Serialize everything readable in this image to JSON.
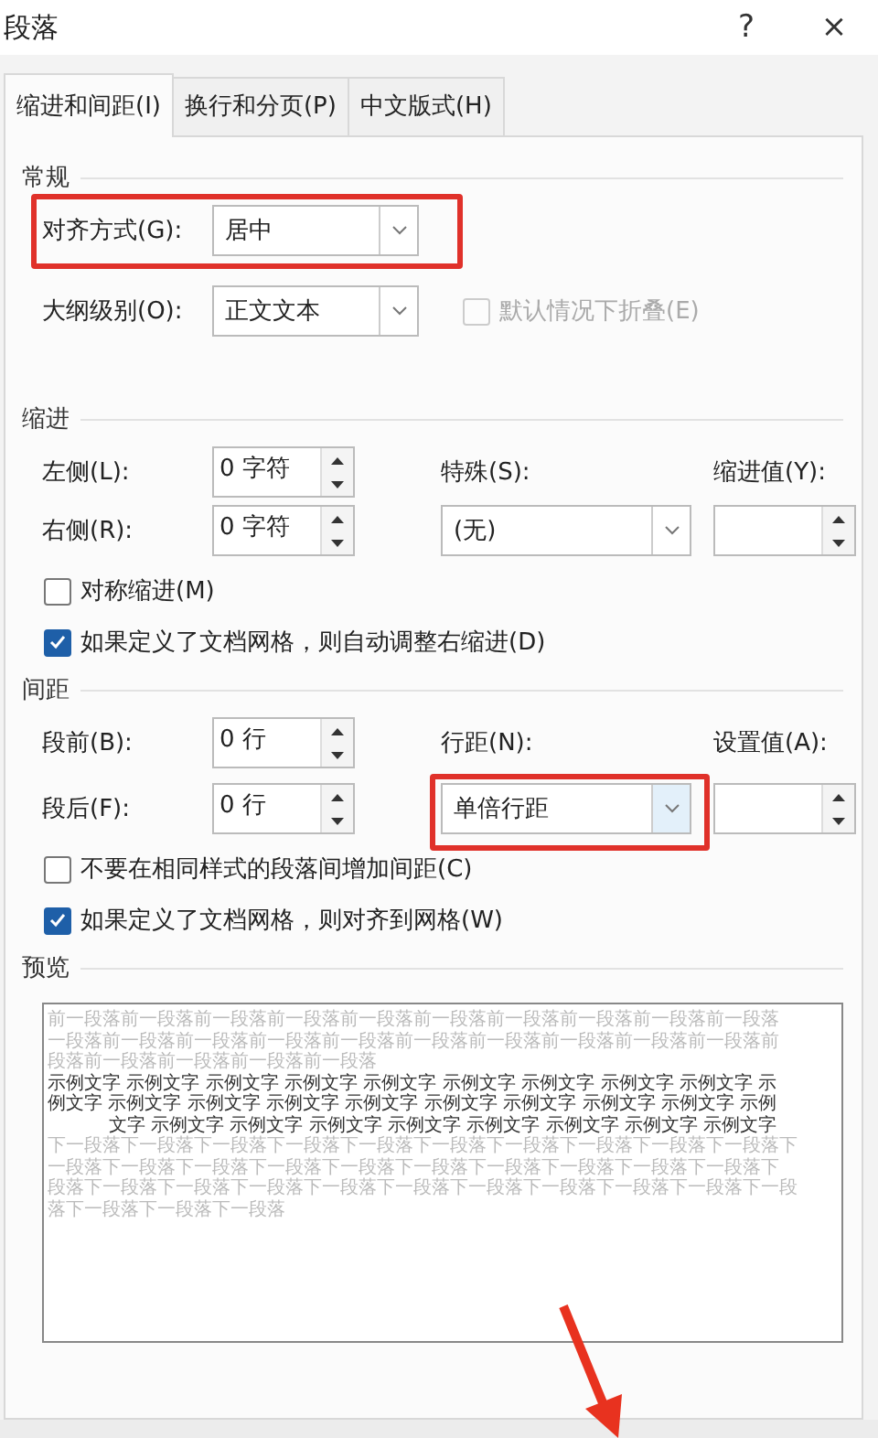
{
  "window": {
    "title": "段落",
    "help": "?",
    "close": "×"
  },
  "tabs": [
    {
      "label": "缩进和间距(I)",
      "selected": true
    },
    {
      "label": "换行和分页(P)",
      "selected": false
    },
    {
      "label": "中文版式(H)",
      "selected": false
    }
  ],
  "general": {
    "heading": "常规",
    "alignment": {
      "label": "对齐方式(G):",
      "value": "居中"
    },
    "outline_level": {
      "label": "大纲级别(O):",
      "value": "正文文本"
    },
    "collapse": {
      "label": "默认情况下折叠(E)",
      "checked": false,
      "disabled": true
    }
  },
  "indent": {
    "heading": "缩进",
    "left": {
      "label": "左侧(L):",
      "value": "0 字符"
    },
    "right": {
      "label": "右侧(R):",
      "value": "0 字符"
    },
    "special": {
      "label": "特殊(S):",
      "value": "(无)"
    },
    "by": {
      "label": "缩进值(Y):"
    },
    "checkboxes": [
      {
        "label": "对称缩进(M)",
        "checked": false
      },
      {
        "label": "如果定义了文档网格，则自动调整右缩进(D)",
        "checked": true
      }
    ]
  },
  "spacing": {
    "heading": "间距",
    "before": {
      "label": "段前(B):",
      "value": "0 行"
    },
    "after": {
      "label": "段后(F):",
      "value": "0 行"
    },
    "line": {
      "label": "行距(N):",
      "value": "单倍行距"
    },
    "at": {
      "label": "设置值(A):"
    },
    "checkboxes": [
      {
        "label": "不要在相同样式的段落间增加间距(C)",
        "checked": false
      },
      {
        "label": "如果定义了文档网格，则对齐到网格(W)",
        "checked": true
      }
    ]
  },
  "preview": {
    "heading": "预览",
    "previous_lines": [
      "前一段落前一段落前一段落前一段落前一段落前一段落前一段落前一段落前一段落前一段落",
      "一段落前一段落前一段落前一段落前一段落前一段落前一段落前一段落前一段落前一段落前",
      "段落前一段落前一段落前一段落前一段落"
    ],
    "sample_lines": [
      "示例文字 示例文字 示例文字 示例文字 示例文字 示例文字 示例文字 示例文字 示例文字 示",
      "例文字 示例文字 示例文字 示例文字 示例文字 示例文字 示例文字 示例文字 示例文字 示例",
      "文字 示例文字 示例文字 示例文字 示例文字 示例文字 示例文字 示例文字 示例文字"
    ],
    "next_lines": [
      "下一段落下一段落下一段落下一段落下一段落下一段落下一段落下一段落下一段落下一段落下",
      "一段落下一段落下一段落下一段落下一段落下一段落下一段落下一段落下一段落下一段落下",
      "段落下一段落下一段落下一段落下一段落下一段落下一段落下一段落下一段落下一段落下一段",
      "落下一段落下一段落下一段落"
    ]
  }
}
